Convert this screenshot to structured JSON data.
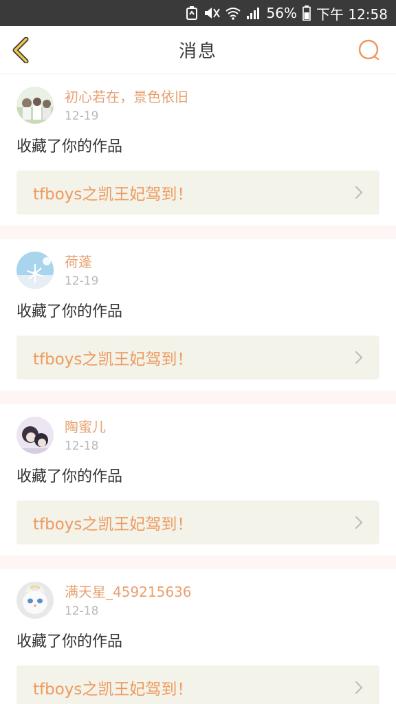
{
  "status_bar": {
    "battery_percent": "56%",
    "time": "下午 12:58",
    "icons": [
      "recycle-icon",
      "mute-icon",
      "wifi-icon",
      "signal-icon",
      "battery-icon"
    ]
  },
  "header": {
    "title": "消息",
    "back_icon": "chevron-left-icon",
    "search_icon": "search-icon"
  },
  "colors": {
    "accent": "#e8a070",
    "work_title": "#ee9a5f",
    "work_bg": "#f3f3ea",
    "separator": "#fdf6f4",
    "back_icon": "#f2c84b"
  },
  "messages": [
    {
      "user": "初心若在，景色依旧",
      "date": "12-19",
      "action": "收藏了你的作品",
      "work_title": "tfboys之凯王妃驾到！"
    },
    {
      "user": "荷蓬",
      "date": "12-19",
      "action": "收藏了你的作品",
      "work_title": "tfboys之凯王妃驾到！"
    },
    {
      "user": "陶蜜儿",
      "date": "12-18",
      "action": "收藏了你的作品",
      "work_title": "tfboys之凯王妃驾到！"
    },
    {
      "user": "满天星_459215636",
      "date": "12-18",
      "action": "收藏了你的作品",
      "work_title": "tfboys之凯王妃驾到！"
    }
  ]
}
